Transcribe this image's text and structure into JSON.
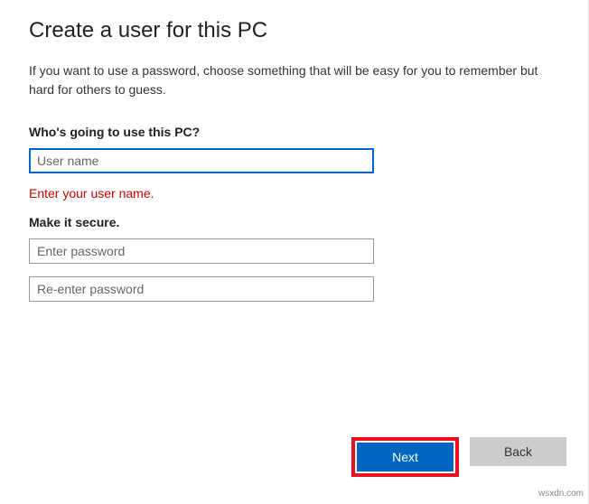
{
  "header": {
    "title": "Create a user for this PC"
  },
  "description": "If you want to use a password, choose something that will be easy for you to remember but hard for others to guess.",
  "sections": {
    "username": {
      "label": "Who's going to use this PC?",
      "placeholder": "User name",
      "value": "",
      "error": "Enter your user name."
    },
    "password": {
      "label": "Make it secure.",
      "field1_placeholder": "Enter password",
      "field1_value": "",
      "field2_placeholder": "Re-enter password",
      "field2_value": ""
    }
  },
  "buttons": {
    "next": "Next",
    "back": "Back"
  },
  "watermark": "wsxdn.com"
}
